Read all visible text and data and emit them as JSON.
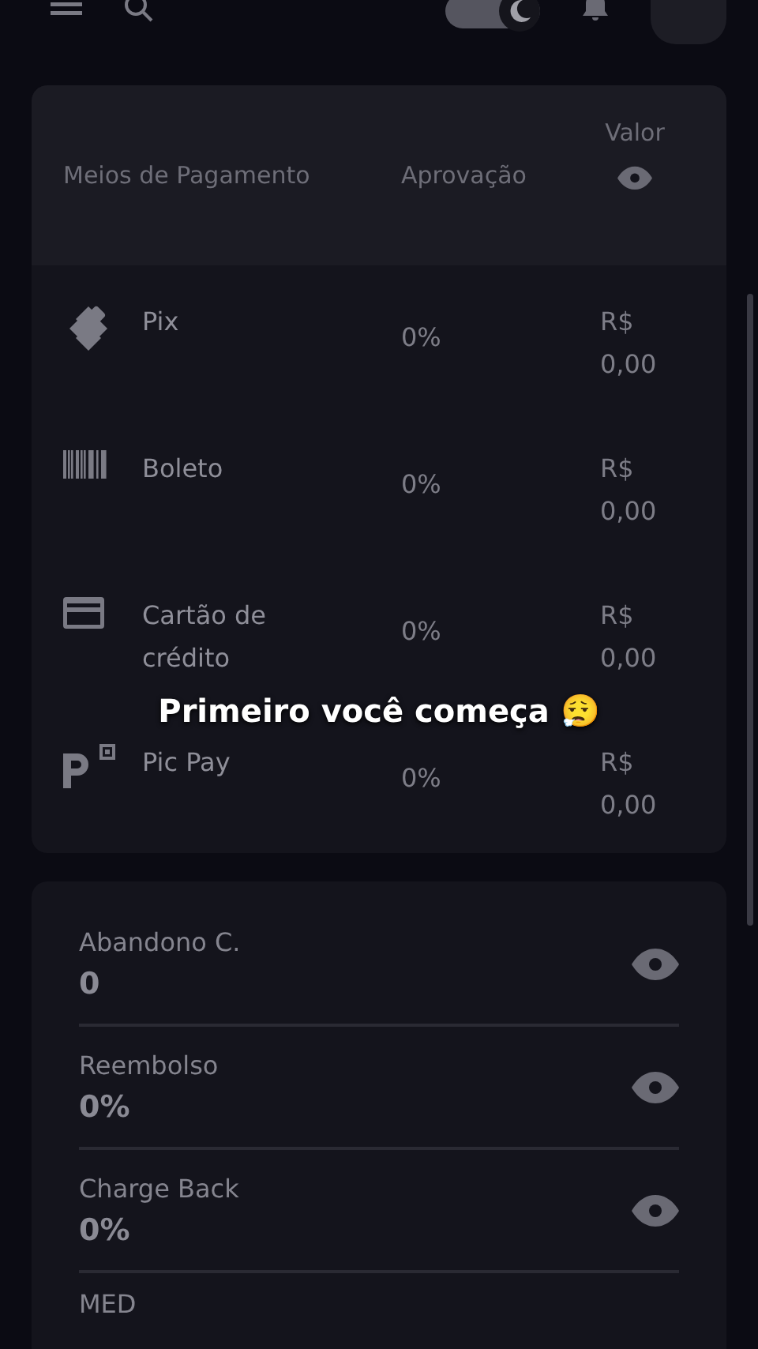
{
  "top_bar": {
    "dark_mode": true
  },
  "payment_table": {
    "columns": [
      "Meios de Pagamento",
      "Aprovação",
      "Valor"
    ],
    "rows": [
      {
        "kind": "pix",
        "method": "Pix",
        "approval": "0%",
        "value": "R$ 0,00"
      },
      {
        "kind": "boleto",
        "method": "Boleto",
        "approval": "0%",
        "value": "R$ 0,00"
      },
      {
        "kind": "card",
        "method": "Cartão de crédito",
        "approval": "0%",
        "value": "R$ 0,00"
      },
      {
        "kind": "picpay",
        "method": "Pic Pay",
        "approval": "0%",
        "value": "R$ 0,00"
      }
    ]
  },
  "metrics": [
    {
      "label": "Abandono C.",
      "value": "0"
    },
    {
      "label": "Reembolso",
      "value": "0%"
    },
    {
      "label": "Charge Back",
      "value": "0%"
    },
    {
      "label": "MED"
    }
  ],
  "caption": "Primeiro você começa 😮‍💨"
}
